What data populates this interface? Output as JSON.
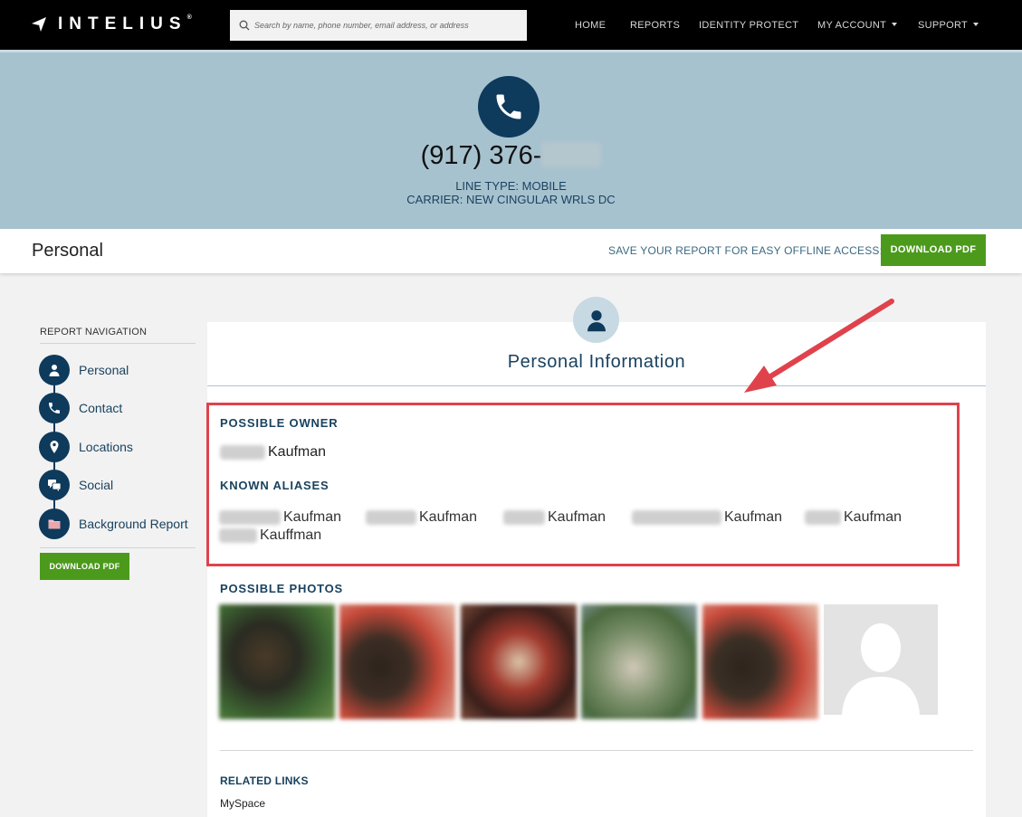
{
  "brand": {
    "name": "INTELIUS",
    "tm": "®"
  },
  "search": {
    "placeholder": "Search by name, phone number, email address, or address"
  },
  "nav": {
    "home": "HOME",
    "reports": "REPORTS",
    "identity_protect": "IDENTITY PROTECT",
    "my_account": "MY ACCOUNT",
    "support": "SUPPORT"
  },
  "hero": {
    "phone_number": "(917) 376-",
    "line_type": "LINE TYPE: MOBILE",
    "carrier": "CARRIER: NEW CINGULAR WRLS DC"
  },
  "section": {
    "title": "Personal",
    "save_text": "SAVE YOUR REPORT FOR EASY OFFLINE ACCESS:",
    "download_label": "DOWNLOAD PDF"
  },
  "sidebar": {
    "heading": "REPORT NAVIGATION",
    "items": [
      {
        "label": "Personal",
        "icon": "person-icon"
      },
      {
        "label": "Contact",
        "icon": "phone-icon"
      },
      {
        "label": "Locations",
        "icon": "map-pin-icon"
      },
      {
        "label": "Social",
        "icon": "chat-bubbles-icon"
      },
      {
        "label": "Background Report",
        "icon": "folder-icon"
      }
    ],
    "download_label": "DOWNLOAD PDF"
  },
  "personal_info": {
    "title": "Personal Information",
    "possible_owner_label": "POSSIBLE OWNER",
    "owner_surname": "Kaufman",
    "known_aliases_label": "KNOWN ALIASES",
    "aliases": [
      "Kaufman",
      "Kaufman",
      "Kaufman",
      "Kaufman",
      "Kaufman",
      "Kauffman"
    ],
    "possible_photos_label": "POSSIBLE PHOTOS",
    "related_links_label": "RELATED LINKS",
    "related_links": [
      "MySpace"
    ]
  },
  "colors": {
    "navy": "#0e3a5c",
    "hero_bg": "#a7c2cf",
    "green": "#4c9a1c",
    "highlight": "#e0424c"
  }
}
